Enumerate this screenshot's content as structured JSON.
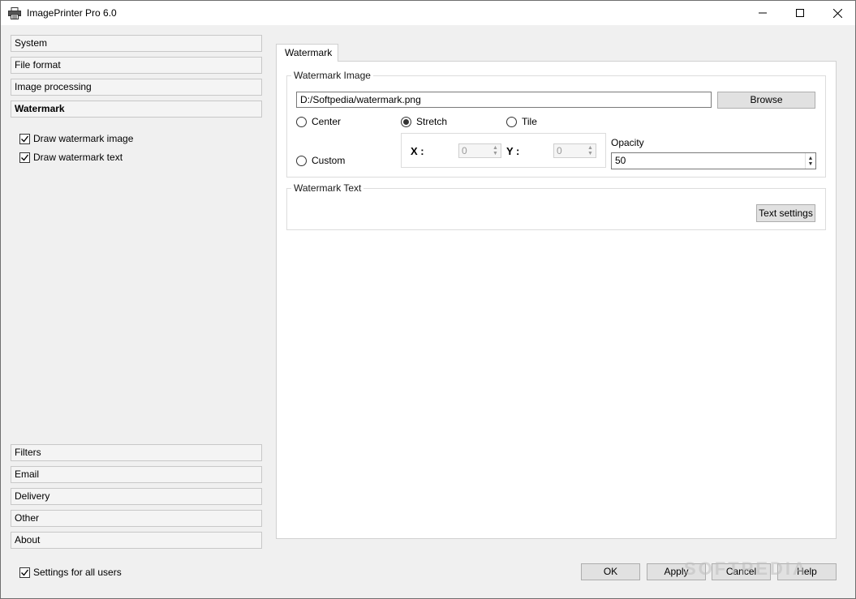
{
  "window": {
    "title": "ImagePrinter Pro 6.0",
    "controls": {
      "minimize": "minimize",
      "maximize": "maximize",
      "close": "close"
    }
  },
  "sidebar": {
    "top_items": [
      {
        "label": "System",
        "active": false
      },
      {
        "label": "File format",
        "active": false
      },
      {
        "label": "Image processing",
        "active": false
      },
      {
        "label": "Watermark",
        "active": true
      }
    ],
    "options": [
      {
        "label": "Draw watermark image",
        "checked": true
      },
      {
        "label": "Draw watermark text",
        "checked": true
      }
    ],
    "bottom_items": [
      {
        "label": "Filters"
      },
      {
        "label": "Email"
      },
      {
        "label": "Delivery"
      },
      {
        "label": "Other"
      },
      {
        "label": "About"
      }
    ],
    "settings_all_users": {
      "label": "Settings for all users",
      "checked": true
    }
  },
  "main": {
    "tab_label": "Watermark",
    "watermark_image": {
      "legend": "Watermark Image",
      "path_value": "D:/Softpedia/watermark.png",
      "browse_label": "Browse",
      "positions": {
        "center": "Center",
        "stretch": "Stretch",
        "tile": "Tile",
        "custom": "Custom",
        "selected": "Stretch"
      },
      "x_label": "X :",
      "x_value": "0",
      "y_label": "Y :",
      "y_value": "0",
      "opacity_label": "Opacity",
      "opacity_value": "50"
    },
    "watermark_text": {
      "legend": "Watermark Text",
      "text_settings_label": "Text settings"
    }
  },
  "footer": {
    "ok": "OK",
    "apply": "Apply",
    "cancel": "Cancel",
    "help": "Help"
  },
  "overlay": {
    "watermark_text": "SOFTPEDIA"
  },
  "colors": {
    "window_bg": "#f0f0f0",
    "panel_bg": "#ffffff",
    "button_bg": "#e1e1e1"
  }
}
